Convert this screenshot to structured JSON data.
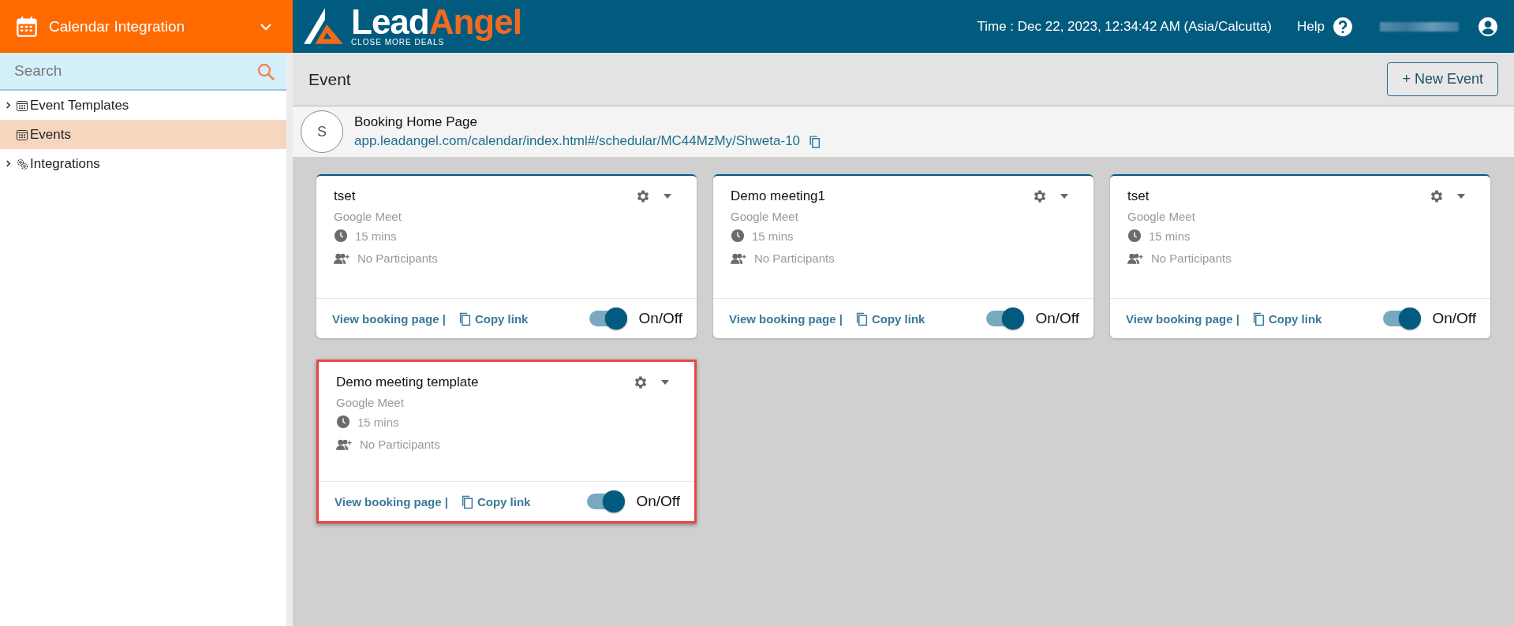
{
  "app_switcher": {
    "title": "Calendar Integration"
  },
  "header": {
    "logo": {
      "name_parts": [
        "Lead",
        "Angel"
      ],
      "tagline": "CLOSE MORE DEALS"
    },
    "time": "Time : Dec 22, 2023, 12:34:42 AM (Asia/Calcutta)",
    "help": "Help",
    "username_redacted": true
  },
  "sidebar": {
    "search": {
      "placeholder": "Search"
    },
    "items": [
      {
        "label": "Event Templates",
        "expandable": true,
        "selected": false
      },
      {
        "label": "Events",
        "expandable": false,
        "selected": true
      },
      {
        "label": "Integrations",
        "expandable": true,
        "selected": false
      }
    ]
  },
  "page": {
    "title": "Event",
    "new_button": "+ New Event"
  },
  "booking": {
    "avatar": "S",
    "title": "Booking Home Page",
    "url": "app.leadangel.com/calendar/index.html#/schedular/MC44MzMy/Shweta-10"
  },
  "events": [
    {
      "name": "tset",
      "platform": "Google Meet",
      "duration": "15 mins",
      "participants": "No Participants",
      "view_link": "View booking page |",
      "copy_link": "Copy link",
      "toggle_label": "On/Off",
      "on": true,
      "highlighted": false
    },
    {
      "name": "Demo meeting1",
      "platform": "Google Meet",
      "duration": "15 mins",
      "participants": "No Participants",
      "view_link": "View booking page |",
      "copy_link": "Copy link",
      "toggle_label": "On/Off",
      "on": true,
      "highlighted": false
    },
    {
      "name": "tset",
      "platform": "Google Meet",
      "duration": "15 mins",
      "participants": "No Participants",
      "view_link": "View booking page |",
      "copy_link": "Copy link",
      "toggle_label": "On/Off",
      "on": true,
      "highlighted": false
    },
    {
      "name": "Demo meeting template",
      "platform": "Google Meet",
      "duration": "15 mins",
      "participants": "No Participants",
      "view_link": "View booking page |",
      "copy_link": "Copy link",
      "toggle_label": "On/Off",
      "on": true,
      "highlighted": true
    }
  ]
}
